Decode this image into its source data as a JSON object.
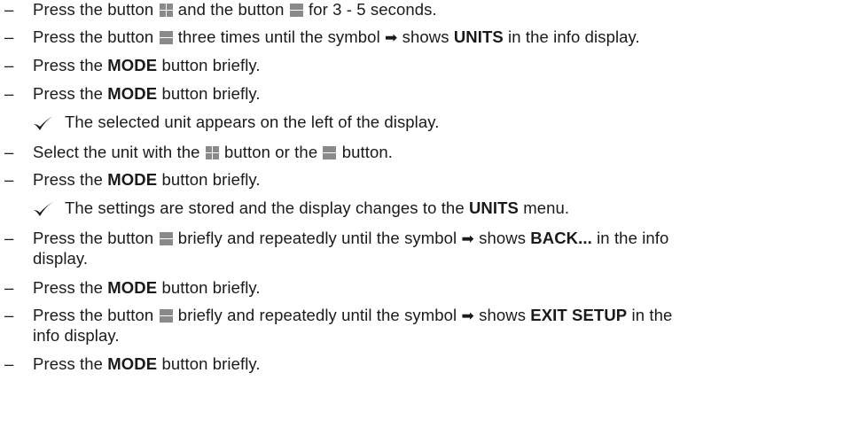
{
  "steps": [
    {
      "kind": "step",
      "parts": [
        {
          "t": "Press the button "
        },
        {
          "icon": "plus-button-icon"
        },
        {
          "t": " and the button "
        },
        {
          "icon": "minus-button-icon"
        },
        {
          "t": " for 3 - 5 seconds."
        }
      ]
    },
    {
      "kind": "step",
      "parts": [
        {
          "t": "Press the button "
        },
        {
          "icon": "minus-button-icon"
        },
        {
          "t": " three times until the symbol "
        },
        {
          "icon": "right-arrow-icon"
        },
        {
          "t": " shows "
        },
        {
          "b": "UNITS"
        },
        {
          "t": " in the info display."
        }
      ]
    },
    {
      "kind": "step",
      "parts": [
        {
          "t": "Press the "
        },
        {
          "b": "MODE"
        },
        {
          "t": " button briefly."
        }
      ]
    },
    {
      "kind": "step",
      "parts": [
        {
          "t": "Press the "
        },
        {
          "b": "MODE"
        },
        {
          "t": " button briefly."
        }
      ]
    },
    {
      "kind": "result",
      "parts": [
        {
          "t": "The selected unit appears on the left of the display."
        }
      ]
    },
    {
      "kind": "step",
      "parts": [
        {
          "t": "Select the unit with the "
        },
        {
          "icon": "plus-button-icon"
        },
        {
          "t": " button or the "
        },
        {
          "icon": "minus-button-icon"
        },
        {
          "t": " button."
        }
      ]
    },
    {
      "kind": "step",
      "parts": [
        {
          "t": "Press the "
        },
        {
          "b": "MODE"
        },
        {
          "t": " button briefly."
        }
      ]
    },
    {
      "kind": "result",
      "parts": [
        {
          "t": "The settings are stored and the display changes to the "
        },
        {
          "b": "UNITS"
        },
        {
          "t": " menu."
        }
      ]
    },
    {
      "kind": "step",
      "parts": [
        {
          "t": "Press the button "
        },
        {
          "icon": "minus-button-icon"
        },
        {
          "t": " briefly and repeatedly until the symbol "
        },
        {
          "icon": "right-arrow-icon"
        },
        {
          "t": " shows "
        },
        {
          "b": "BACK..."
        },
        {
          "t": " in the info"
        }
      ]
    },
    {
      "kind": "cont",
      "parts": [
        {
          "t": "display."
        }
      ]
    },
    {
      "kind": "step",
      "parts": [
        {
          "t": "Press the "
        },
        {
          "b": "MODE"
        },
        {
          "t": " button briefly."
        }
      ]
    },
    {
      "kind": "step",
      "parts": [
        {
          "t": "Press the button "
        },
        {
          "icon": "minus-button-icon"
        },
        {
          "t": " briefly and repeatedly until the symbol "
        },
        {
          "icon": "right-arrow-icon"
        },
        {
          "t": " shows "
        },
        {
          "b": "EXIT SETUP"
        },
        {
          "t": " in the"
        }
      ]
    },
    {
      "kind": "cont",
      "parts": [
        {
          "t": "info display."
        }
      ]
    },
    {
      "kind": "step",
      "parts": [
        {
          "t": "Press the "
        },
        {
          "b": "MODE"
        },
        {
          "t": " button briefly."
        }
      ]
    }
  ],
  "dash_glyph": "–",
  "arrow_glyph": "➡",
  "icon_color": "#8a8a8a"
}
